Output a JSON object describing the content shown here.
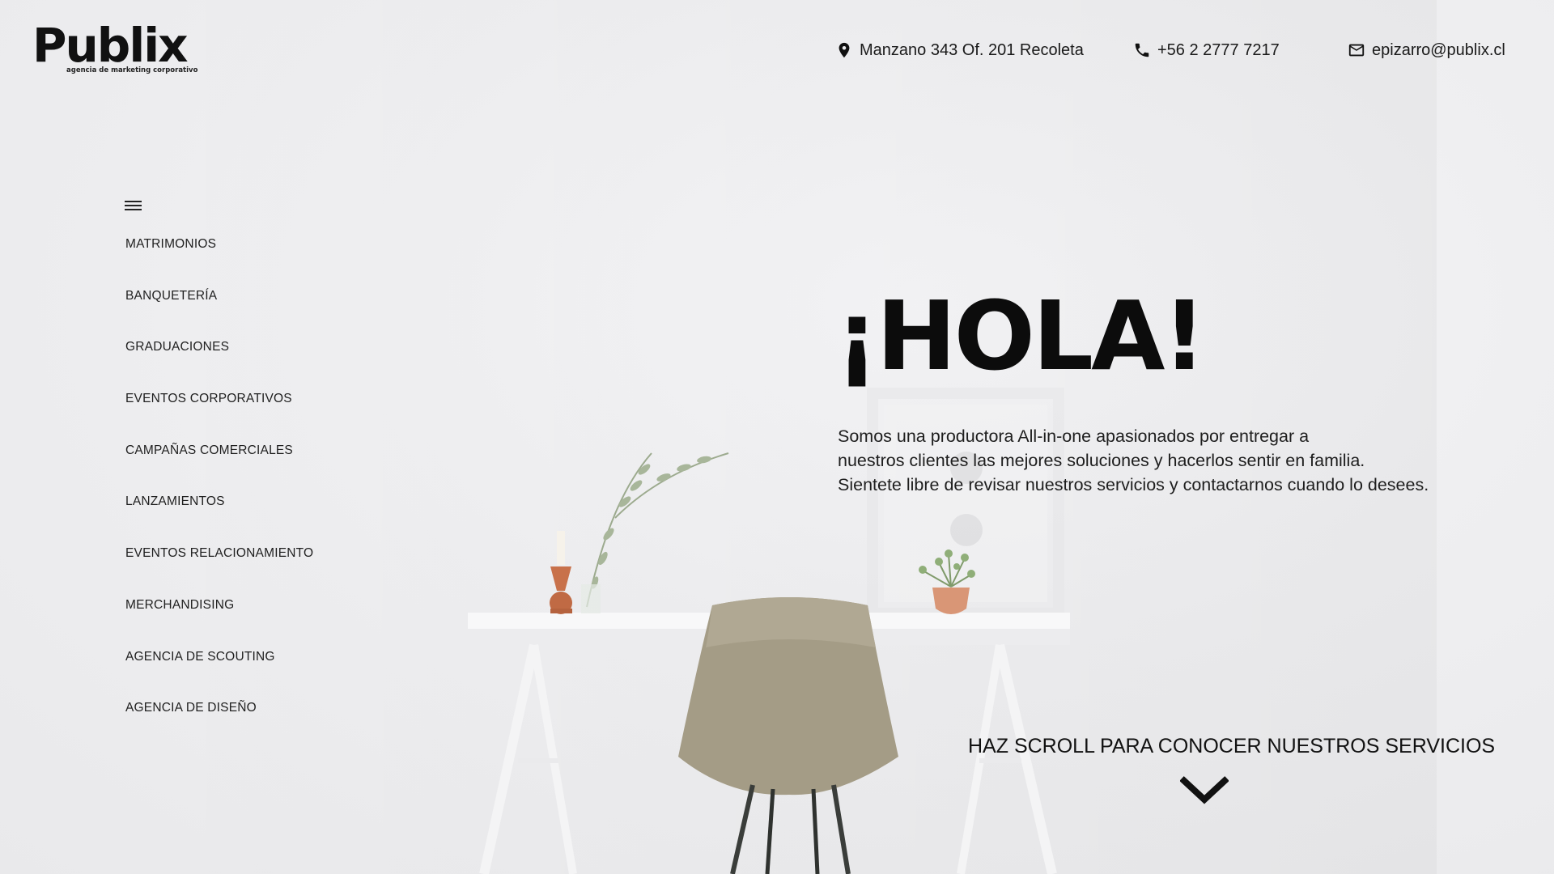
{
  "brand": {
    "name": "Publix",
    "tagline": "agencia de marketing corporativo"
  },
  "header": {
    "address": {
      "icon": "map-pin-icon",
      "text": "Manzano 343 Of. 201 Recoleta"
    },
    "phone": {
      "icon": "phone-icon",
      "text": "+56 2 2777 7217"
    },
    "email": {
      "icon": "mail-icon",
      "text": "epizarro@publix.cl"
    }
  },
  "menu": {
    "toggle_icon": "hamburger-menu-icon",
    "items": [
      {
        "label": "MATRIMONIOS"
      },
      {
        "label": "BANQUETERÍA"
      },
      {
        "label": "GRADUACIONES"
      },
      {
        "label": "EVENTOS CORPORATIVOS"
      },
      {
        "label": "CAMPAÑAS COMERCIALES"
      },
      {
        "label": "LANZAMIENTOS"
      },
      {
        "label": "EVENTOS RELACIONAMIENTO"
      },
      {
        "label": "MERCHANDISING"
      },
      {
        "label": "AGENCIA DE SCOUTING"
      },
      {
        "label": "AGENCIA DE DISEÑO"
      }
    ]
  },
  "hero": {
    "title": "¡HOLA!",
    "lines": [
      "Somos una productora All-in-one apasionados por entregar a",
      "nuestros clientes las mejores soluciones y hacerlos sentir en familia.",
      "Sientete libre de revisar nuestros servicios y contactarnos cuando lo desees."
    ],
    "scroll_label": "HAZ SCROLL PARA CONOCER NUESTROS SERVICIOS",
    "scroll_icon": "chevron-down-icon"
  },
  "colors": {
    "background": "#eeeef0",
    "text": "#111111",
    "chair": "#a49c86",
    "copper": "#c8714a"
  }
}
